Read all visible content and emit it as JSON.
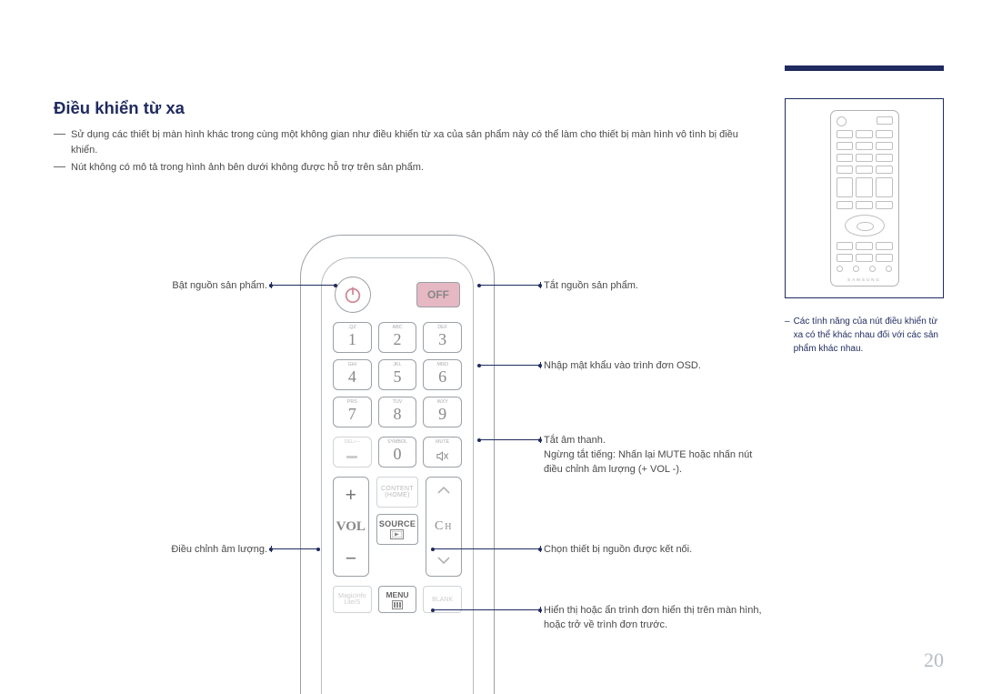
{
  "section_title": "Điều khiển từ xa",
  "intro_notes": [
    "Sử dụng các thiết bị màn hình khác trong cùng một không gian như điều khiển từ xa của sản phẩm này có thể làm cho thiết bị màn hình vô tình bị điều khiển.",
    "Nút không có mô tả trong hình ảnh bên dưới không được hỗ trợ trên sản phẩm."
  ],
  "side_note": "Các tính năng của nút điều khiển từ xa có thể khác nhau đối với các sản phẩm khác nhau.",
  "thumbnail_brand": "SAMSUNG",
  "remote": {
    "off_label": "OFF",
    "keypad": [
      {
        "num": "1",
        "label": ",QZ"
      },
      {
        "num": "2",
        "label": "ABC"
      },
      {
        "num": "3",
        "label": "DEF"
      },
      {
        "num": "4",
        "label": "GHI"
      },
      {
        "num": "5",
        "label": "JKL"
      },
      {
        "num": "6",
        "label": "MNO"
      },
      {
        "num": "7",
        "label": "PRS"
      },
      {
        "num": "8",
        "label": "TUV"
      },
      {
        "num": "9",
        "label": "WXY"
      }
    ],
    "del_label": "DEL/—",
    "symbol_label": "SYMBOL",
    "zero": "0",
    "mute_label": "MUTE",
    "vol_label": "VOL",
    "ch_label": "Ch",
    "content_label": "CONTENT",
    "home_label": "(HOME)",
    "source_label": "SOURCE",
    "menu_label": "MENU",
    "magicinfo_label_1": "MagicInfo",
    "magicinfo_label_2": "Lite/S",
    "blank_label": "BLANK"
  },
  "callouts": {
    "left_power_on": "Bật nguồn sản phẩm.",
    "left_volume": "Điều chỉnh âm lượng.",
    "right_power_off": "Tắt nguồn sản phẩm.",
    "right_keypad": "Nhập mật khẩu vào trình đơn OSD.",
    "right_mute_1": "Tắt âm thanh.",
    "right_mute_2": "Ngừng tắt tiếng: Nhấn lại MUTE hoặc nhấn nút điều chỉnh âm lượng (+ VOL -).",
    "right_source": "Chọn thiết bị nguồn được kết nối.",
    "right_menu": "Hiển thị hoặc ẩn trình đơn hiển thị trên màn hình, hoặc trở về trình đơn trước."
  },
  "page_number": "20"
}
